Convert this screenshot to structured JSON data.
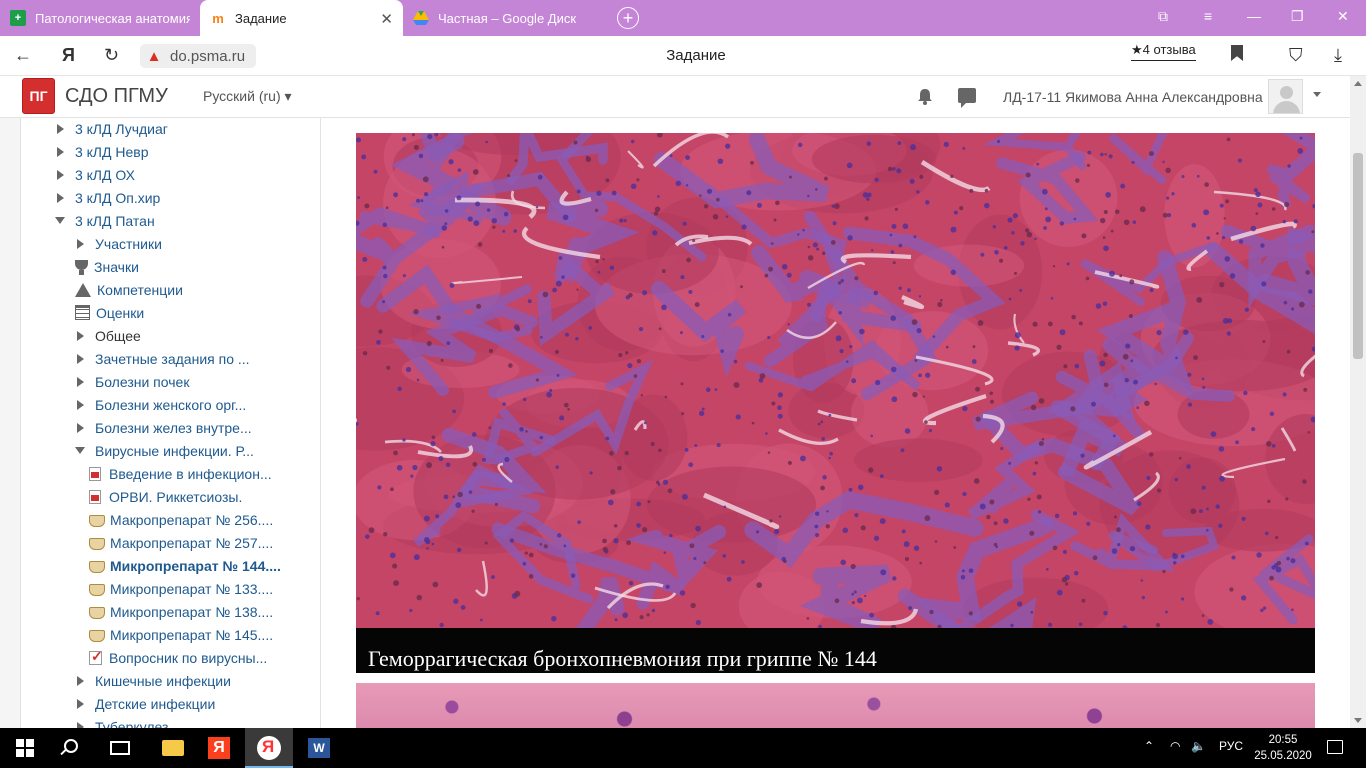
{
  "browser": {
    "tabs": [
      {
        "title": "Патологическая анатомия",
        "icon": "sheet-icon",
        "active": false
      },
      {
        "title": "Задание",
        "icon": "moodle-icon",
        "active": true
      },
      {
        "title": "Частная – Google Диск",
        "icon": "google-drive-icon",
        "active": false
      }
    ],
    "address": "do.psma.ru",
    "page_title": "Задание",
    "reviews": "4 отзыва",
    "back_glyph": "←",
    "yandex_glyph": "Я",
    "reload_glyph": "↻",
    "warn_glyph": "▲",
    "close_glyph": "✕",
    "plus_glyph": "+",
    "ext_glyph": "⧉",
    "menu_glyph": "≡",
    "min_glyph": "—",
    "restore_glyph": "❐",
    "win_close_glyph": "✕",
    "protect_glyph": "⛉",
    "download_glyph": "⤓",
    "star_glyph": "★"
  },
  "moodle": {
    "logo_text": "ПГ",
    "site_name": "СДО ПГМУ",
    "language": "Русский (ru)",
    "username": "ЛД-17-11 Якимова Анна Александровна"
  },
  "sidebar": {
    "items": [
      {
        "label": "3 кЛД Лучдиаг",
        "type": "tri-r",
        "level": 0,
        "style": "link"
      },
      {
        "label": "3 кЛД Невр",
        "type": "tri-r",
        "level": 0,
        "style": "link"
      },
      {
        "label": "3 кЛД ОХ",
        "type": "tri-r",
        "level": 0,
        "style": "link"
      },
      {
        "label": "3 кЛД Оп.хир",
        "type": "tri-r",
        "level": 0,
        "style": "link"
      },
      {
        "label": "3 кЛД Патан",
        "type": "tri-d",
        "level": 0,
        "style": "link"
      },
      {
        "label": "Участники",
        "type": "tri-r",
        "level": 1,
        "style": "link"
      },
      {
        "label": "Значки",
        "type": "trophy",
        "level": 1,
        "style": "link"
      },
      {
        "label": "Компетенции",
        "type": "comp",
        "level": 1,
        "style": "link"
      },
      {
        "label": "Оценки",
        "type": "grid",
        "level": 1,
        "style": "link"
      },
      {
        "label": "Общее",
        "type": "tri-r",
        "level": 1,
        "style": "dark"
      },
      {
        "label": "Зачетные задания по ...",
        "type": "tri-r",
        "level": 1,
        "style": "link"
      },
      {
        "label": "Болезни почек",
        "type": "tri-r",
        "level": 1,
        "style": "link"
      },
      {
        "label": "Болезни женского орг...",
        "type": "tri-r",
        "level": 1,
        "style": "link"
      },
      {
        "label": "Болезни желез внутре...",
        "type": "tri-r",
        "level": 1,
        "style": "link"
      },
      {
        "label": "Вирусные инфекции. Р...",
        "type": "tri-d",
        "level": 1,
        "style": "link"
      },
      {
        "label": "Введение в инфекцион...",
        "type": "pdf",
        "level": 2,
        "style": "link"
      },
      {
        "label": "ОРВИ. Риккетсиозы.",
        "type": "pdf",
        "level": 2,
        "style": "link"
      },
      {
        "label": "Макропрепарат № 256....",
        "type": "lesson",
        "level": 2,
        "style": "link"
      },
      {
        "label": "Макропрепарат № 257....",
        "type": "lesson",
        "level": 2,
        "style": "link"
      },
      {
        "label": "Микропрепарат № 144....",
        "type": "lesson",
        "level": 2,
        "style": "bold"
      },
      {
        "label": "Микропрепарат № 133....",
        "type": "lesson",
        "level": 2,
        "style": "link"
      },
      {
        "label": "Микропрепарат № 138....",
        "type": "lesson",
        "level": 2,
        "style": "link"
      },
      {
        "label": "Микропрепарат № 145....",
        "type": "lesson",
        "level": 2,
        "style": "link"
      },
      {
        "label": "Вопросник по вирусны...",
        "type": "quiz",
        "level": 2,
        "style": "link"
      },
      {
        "label": "Кишечные инфекции",
        "type": "tri-r",
        "level": 1,
        "style": "link"
      },
      {
        "label": "Детские инфекции",
        "type": "tri-r",
        "level": 1,
        "style": "link"
      },
      {
        "label": "Туберкулез",
        "type": "tri-r",
        "level": 1,
        "style": "link"
      }
    ]
  },
  "main": {
    "caption": "Геморрагическая бронхопневмония при гриппе № 144"
  },
  "taskbar": {
    "language": "РУС",
    "time": "20:55",
    "date": "25.05.2020",
    "up_glyph": "⌃",
    "wifi_glyph": "◠",
    "sound_glyph": "🔈"
  }
}
